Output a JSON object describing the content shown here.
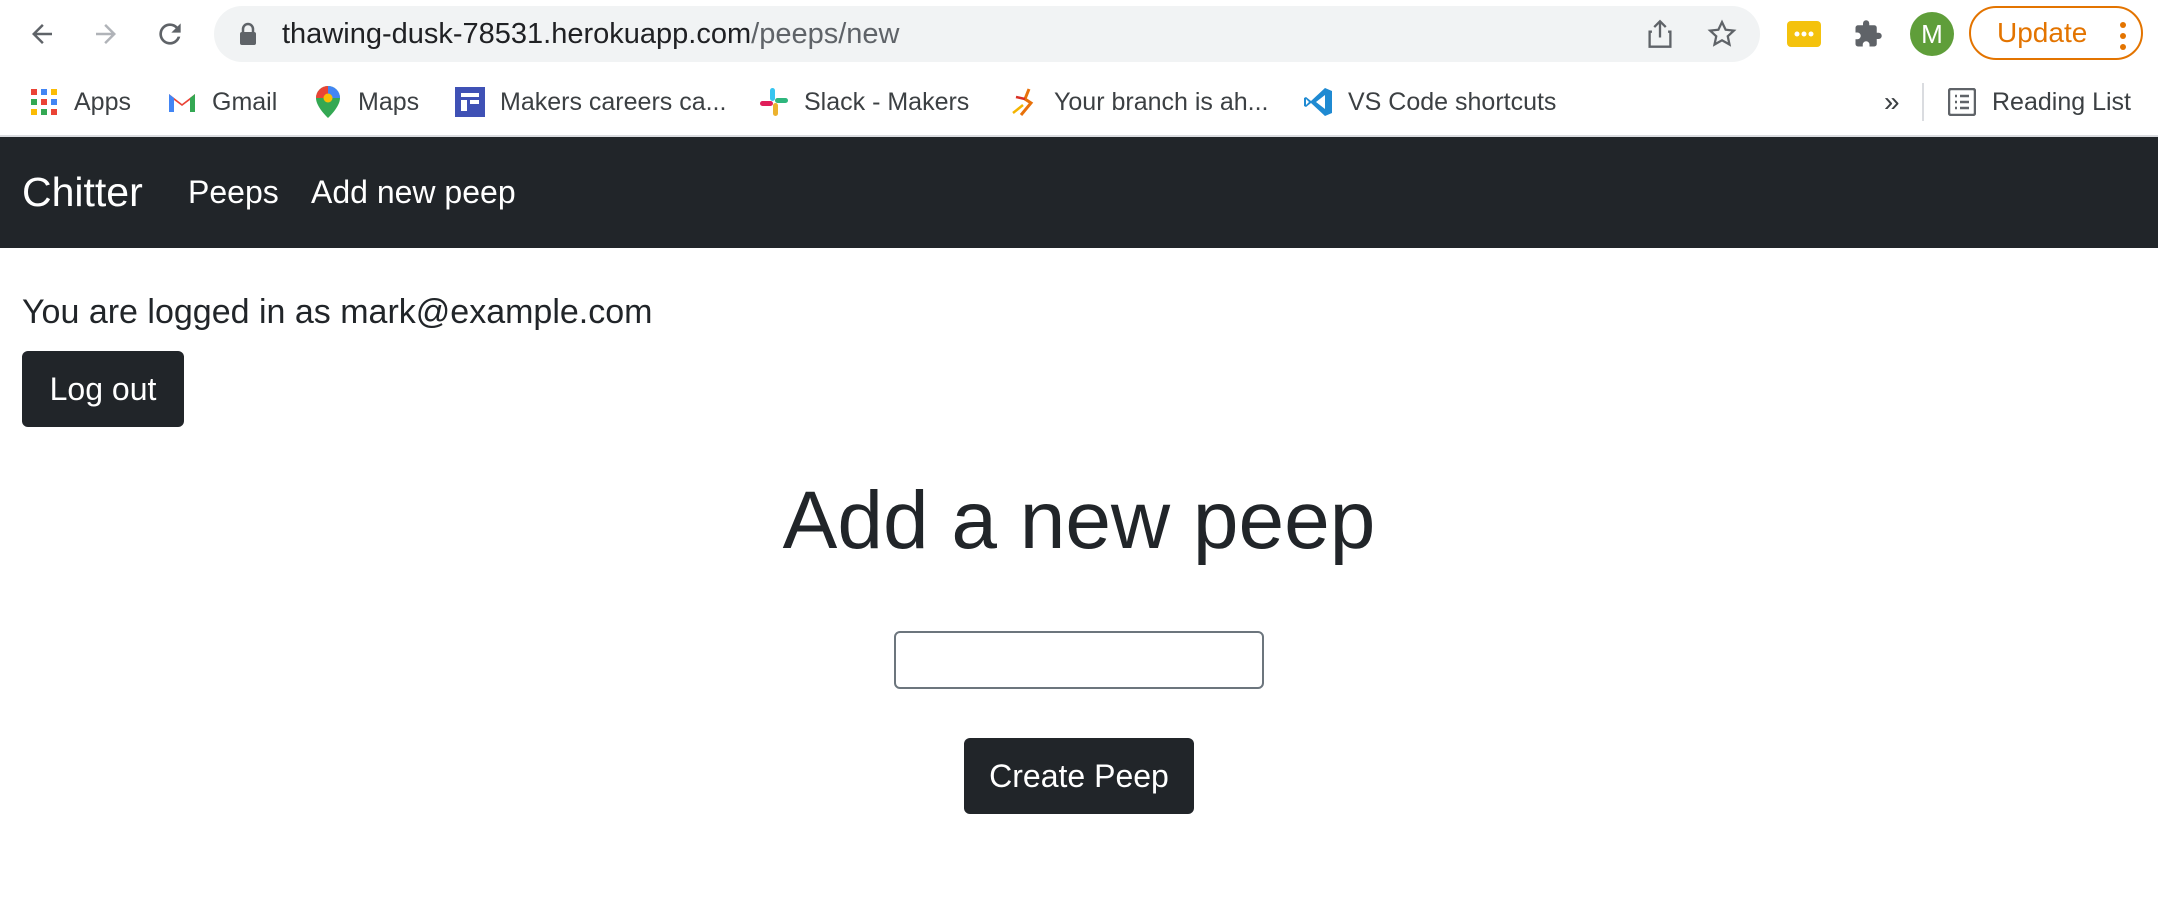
{
  "browser": {
    "url_host": "thawing-dusk-78531.herokuapp.com",
    "url_path": "/peeps/new",
    "avatar_letter": "M",
    "update_label": "Update",
    "bookmarks": [
      {
        "label": "Apps",
        "icon": "apps-grid-icon"
      },
      {
        "label": "Gmail",
        "icon": "gmail-icon"
      },
      {
        "label": "Maps",
        "icon": "maps-pin-icon"
      },
      {
        "label": "Makers careers ca...",
        "icon": "makers-icon"
      },
      {
        "label": "Slack - Makers",
        "icon": "slack-icon"
      },
      {
        "label": "Your branch is ah...",
        "icon": "runner-icon"
      },
      {
        "label": "VS Code shortcuts",
        "icon": "vscode-icon"
      }
    ],
    "overflow_label": "»",
    "reading_list_label": "Reading List"
  },
  "navbar": {
    "brand": "Chitter",
    "links": [
      "Peeps",
      "Add new peep"
    ]
  },
  "main": {
    "logged_in_text": "You are logged in as mark@example.com",
    "logout_label": "Log out",
    "heading": "Add a new peep",
    "peep_input_value": "",
    "submit_label": "Create Peep"
  },
  "colors": {
    "navbar_bg": "#212529",
    "button_bg": "#212529",
    "update_accent": "#e37400",
    "avatar_bg": "#5f9e3a"
  }
}
